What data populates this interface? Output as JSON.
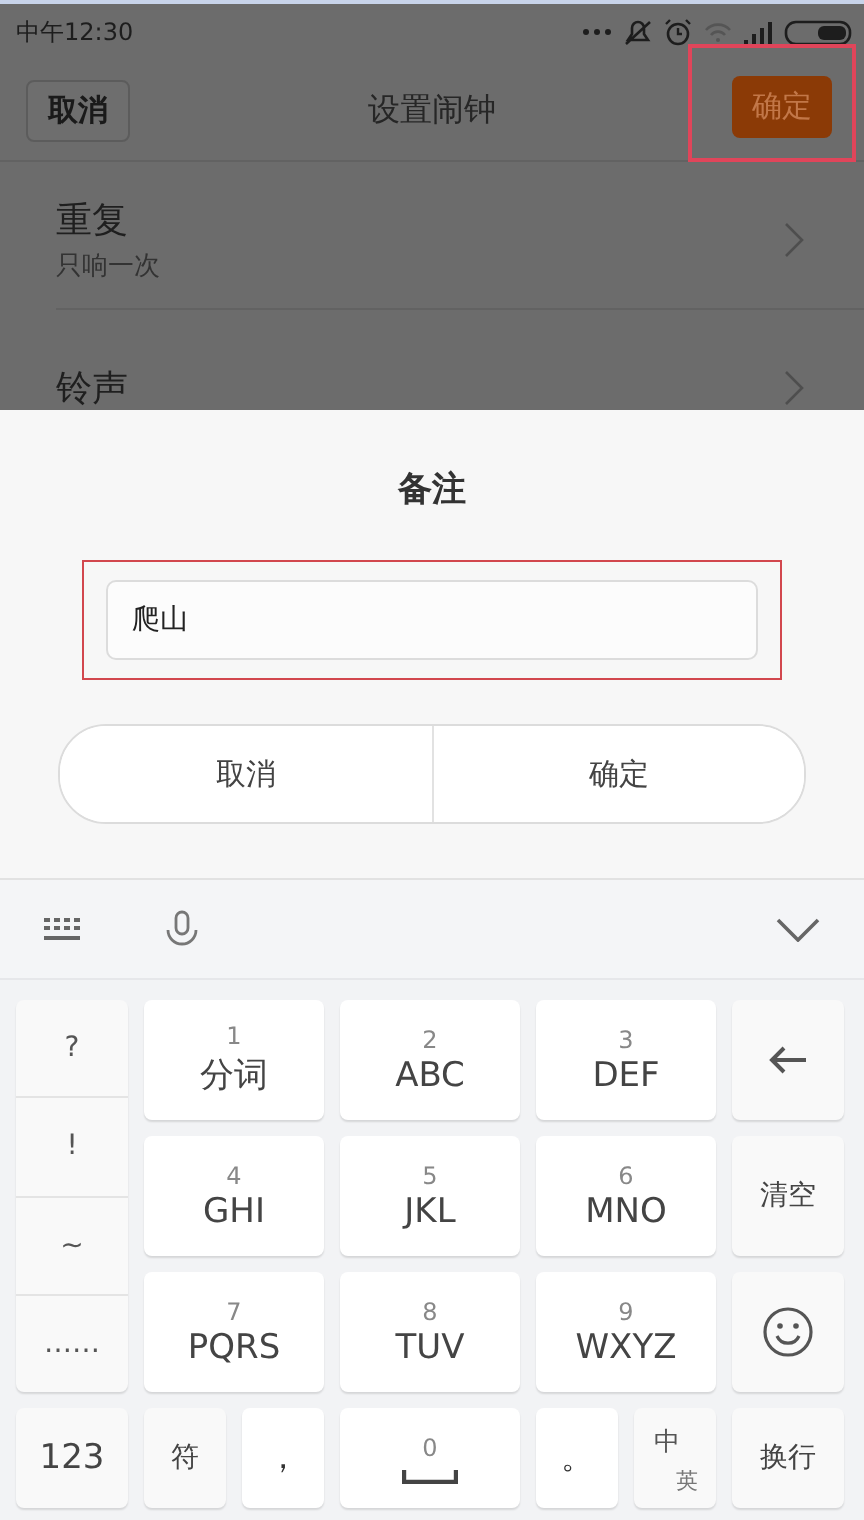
{
  "status_bar": {
    "time": "中午12:30"
  },
  "nav": {
    "cancel": "取消",
    "title": "设置闹钟",
    "confirm": {
      "label": "确定",
      "highlighted": true
    }
  },
  "settings": [
    {
      "label": "重复",
      "value": "只响一次"
    },
    {
      "label": "铃声"
    }
  ],
  "dialog": {
    "title": "备注",
    "field": {
      "value": "爬山",
      "highlighted": true
    },
    "buttons": [
      "取消",
      "确定"
    ]
  },
  "keyboard": {
    "symbols": [
      "?",
      "!",
      "~",
      "……"
    ],
    "digit_keys": [
      {
        "digit": "1",
        "label": "分词"
      },
      {
        "digit": "2",
        "label": "ABC"
      },
      {
        "digit": "3",
        "label": "DEF"
      },
      {
        "digit": "4",
        "label": "GHI"
      },
      {
        "digit": "5",
        "label": "JKL"
      },
      {
        "digit": "6",
        "label": "MNO"
      },
      {
        "digit": "7",
        "label": "PQRS"
      },
      {
        "digit": "8",
        "label": "TUV"
      },
      {
        "digit": "9",
        "label": "WXYZ"
      }
    ],
    "clear_key": "清空",
    "bottom_row": {
      "mode": "123",
      "symbols": "符",
      "comma": "，",
      "space_digit": "0",
      "period": "。",
      "lang": [
        "中",
        "英"
      ],
      "enter": "换行"
    }
  }
}
